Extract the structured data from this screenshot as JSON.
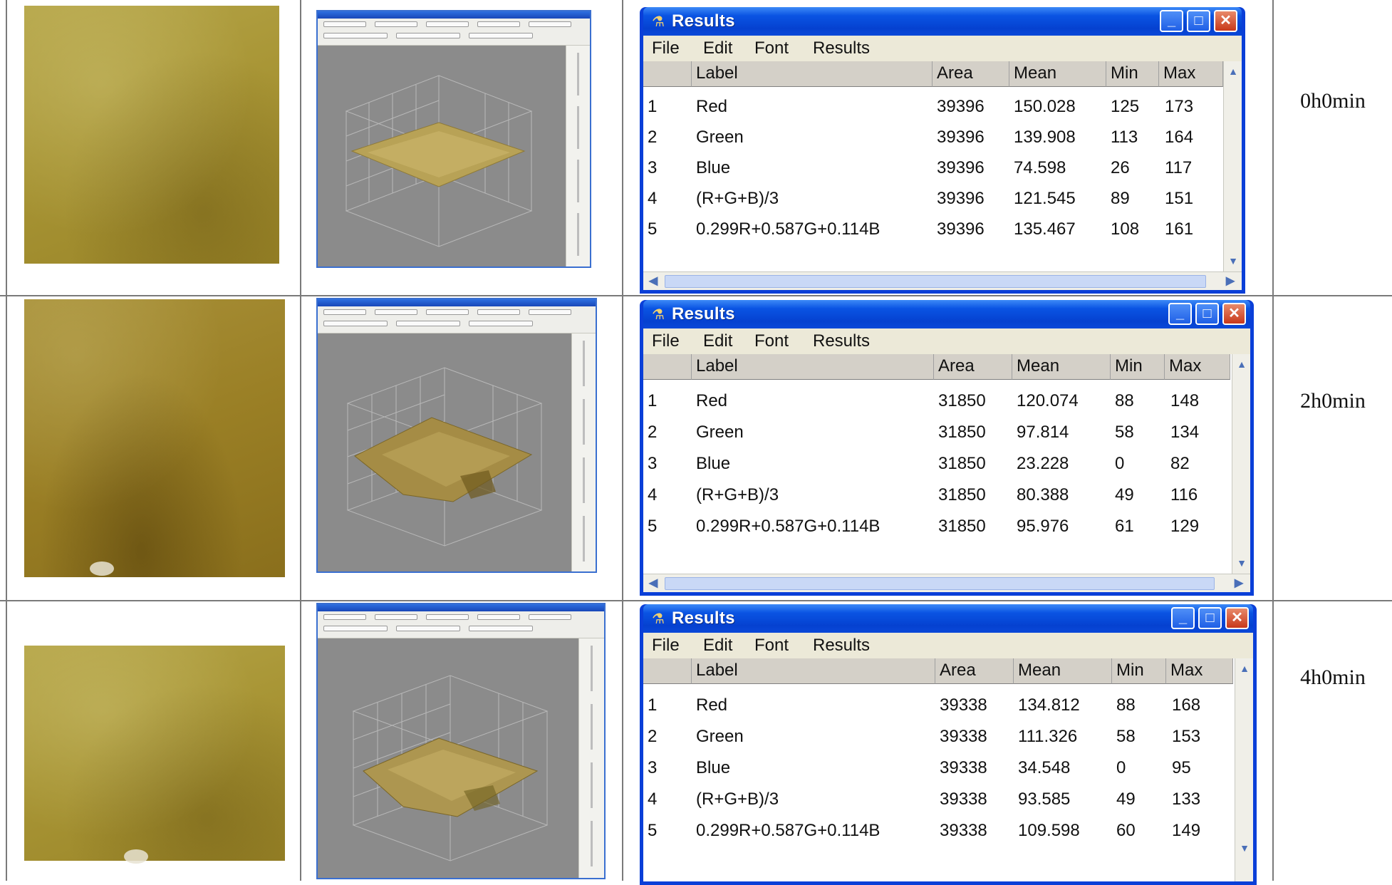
{
  "windows": [
    {
      "title": "Results",
      "menu": [
        "File",
        "Edit",
        "Font",
        "Results"
      ],
      "columns": [
        "",
        "Label",
        "Area",
        "Mean",
        "Min",
        "Max"
      ],
      "rows": [
        [
          "1",
          "Red",
          "39396",
          "150.028",
          "125",
          "173"
        ],
        [
          "2",
          "Green",
          "39396",
          "139.908",
          "113",
          "164"
        ],
        [
          "3",
          "Blue",
          "39396",
          "74.598",
          "26",
          "117"
        ],
        [
          "4",
          "(R+G+B)/3",
          "39396",
          "121.545",
          "89",
          "151"
        ],
        [
          "5",
          "0.299R+0.587G+0.114B",
          "39396",
          "135.467",
          "108",
          "161"
        ]
      ],
      "time": "0h0min"
    },
    {
      "title": "Results",
      "menu": [
        "File",
        "Edit",
        "Font",
        "Results"
      ],
      "columns": [
        "",
        "Label",
        "Area",
        "Mean",
        "Min",
        "Max"
      ],
      "rows": [
        [
          "1",
          "Red",
          "31850",
          "120.074",
          "88",
          "148"
        ],
        [
          "2",
          "Green",
          "31850",
          "97.814",
          "58",
          "134"
        ],
        [
          "3",
          "Blue",
          "31850",
          "23.228",
          "0",
          "82"
        ],
        [
          "4",
          "(R+G+B)/3",
          "31850",
          "80.388",
          "49",
          "116"
        ],
        [
          "5",
          "0.299R+0.587G+0.114B",
          "31850",
          "95.976",
          "61",
          "129"
        ]
      ],
      "time": "2h0min"
    },
    {
      "title": "Results",
      "menu": [
        "File",
        "Edit",
        "Font",
        "Results"
      ],
      "columns": [
        "",
        "Label",
        "Area",
        "Mean",
        "Min",
        "Max"
      ],
      "rows": [
        [
          "1",
          "Red",
          "39338",
          "134.812",
          "88",
          "168"
        ],
        [
          "2",
          "Green",
          "39338",
          "111.326",
          "58",
          "153"
        ],
        [
          "3",
          "Blue",
          "39338",
          "34.548",
          "0",
          "95"
        ],
        [
          "4",
          "(R+G+B)/3",
          "39338",
          "93.585",
          "49",
          "133"
        ],
        [
          "5",
          "0.299R+0.587G+0.114B",
          "39338",
          "109.598",
          "60",
          "149"
        ]
      ],
      "time": "4h0min"
    }
  ],
  "icons": {
    "app": "microscope-icon",
    "minimize": "minimize-icon",
    "maximize": "maximize-icon",
    "close": "close-icon",
    "scroll_up": "chevron-up-icon",
    "scroll_down": "chevron-down-icon",
    "scroll_left": "chevron-left-icon",
    "scroll_right": "chevron-right-icon"
  },
  "colors": {
    "titlebar": "#0a54e3",
    "menubar": "#ece9d8",
    "close_button": "#c8381a",
    "grid_lines": "#7a7a7a"
  }
}
